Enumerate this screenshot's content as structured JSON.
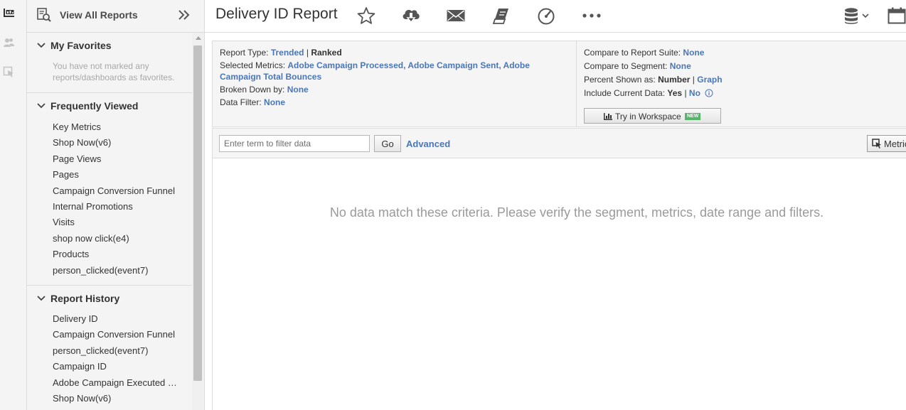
{
  "sidebar": {
    "view_all_label": "View All Reports",
    "favorites": {
      "title": "My Favorites",
      "empty_text": "You have not marked any reports/dashboards as favorites."
    },
    "frequently_viewed": {
      "title": "Frequently Viewed",
      "items": [
        "Key Metrics",
        "Shop Now(v6)",
        "Page Views",
        "Pages",
        "Campaign Conversion Funnel",
        "Internal Promotions",
        "Visits",
        "shop now click(e4)",
        "Products",
        "person_clicked(event7)"
      ]
    },
    "report_history": {
      "title": "Report History",
      "items": [
        "Delivery ID",
        "Campaign Conversion Funnel",
        "person_clicked(event7)",
        "Campaign ID",
        "Adobe Campaign Executed Deliveries",
        "Shop Now(v6)"
      ]
    }
  },
  "header": {
    "title": "Delivery ID Report",
    "icons": [
      "star-icon",
      "cloud-download-icon",
      "mail-icon",
      "bookmark-icon",
      "speedometer-icon",
      "more-icon",
      "database-icon",
      "calendar-icon"
    ]
  },
  "criteria": {
    "report_type_label": "Report Type:",
    "report_type_trended": "Trended",
    "report_type_sep": "|",
    "report_type_ranked": "Ranked",
    "selected_metrics_label": "Selected Metrics:",
    "selected_metrics_value": "Adobe Campaign Processed, Adobe Campaign Sent, Adobe Campaign Total Bounces",
    "broken_down_label": "Broken Down by:",
    "broken_down_value": "None",
    "data_filter_label": "Data Filter:",
    "data_filter_value": "None",
    "compare_suite_label": "Compare to Report Suite:",
    "compare_suite_value": "None",
    "compare_segment_label": "Compare to Segment:",
    "compare_segment_value": "None",
    "percent_shown_label": "Percent Shown as:",
    "percent_number": "Number",
    "percent_sep": "|",
    "percent_graph": "Graph",
    "include_current_label": "Include Current Data:",
    "include_yes": "Yes",
    "include_sep": "|",
    "include_no": "No",
    "workspace_button": "Try in Workspace",
    "workspace_badge": "NEW"
  },
  "filter": {
    "placeholder": "Enter term to filter data",
    "go_label": "Go",
    "advanced_label": "Advanced",
    "metrics_label": "Metrics"
  },
  "report": {
    "no_data_message": "No data match these criteria. Please verify the segment, metrics, date range and filters."
  },
  "colors": {
    "link_blue": "#4a76b8",
    "panel_bg": "#f5f5f5",
    "sidebar_bg": "#f4f4f4",
    "new_badge": "#56b56a"
  }
}
